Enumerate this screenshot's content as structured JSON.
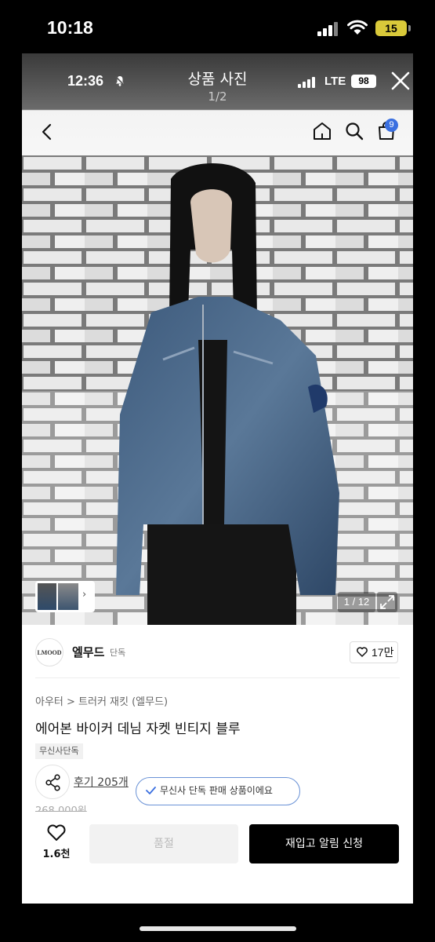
{
  "os_status": {
    "time": "10:18",
    "battery": "15"
  },
  "viewer": {
    "time": "12:36",
    "title": "상품 사진",
    "counter": "1/2",
    "lte": "LTE",
    "battery": "98"
  },
  "shop_header": {
    "cart_count": "9"
  },
  "photo": {
    "counter": "1 / 12"
  },
  "brand": {
    "logo_text": "LMOOD",
    "name": "엘무드",
    "tag": "단독",
    "likes": "17만"
  },
  "product": {
    "breadcrumb": "아우터 > 트러커 재킷 (엘무드)",
    "title": "에어본 바이커 데님 자켓 빈티지 블루",
    "exclusive_badge": "무신사단독",
    "review_link": "후기 205개",
    "info_pill": "무신사 단독 판매 상품이에요",
    "old_price": "268,000원"
  },
  "bottom_bar": {
    "fav_count": "1.6천",
    "soldout_label": "품절",
    "restock_label": "재입고 알림 신청"
  },
  "colors": {
    "accent_blue": "#3a6fe0",
    "pill_border": "#6a92d6",
    "battery_yellow": "#d9c93a"
  }
}
